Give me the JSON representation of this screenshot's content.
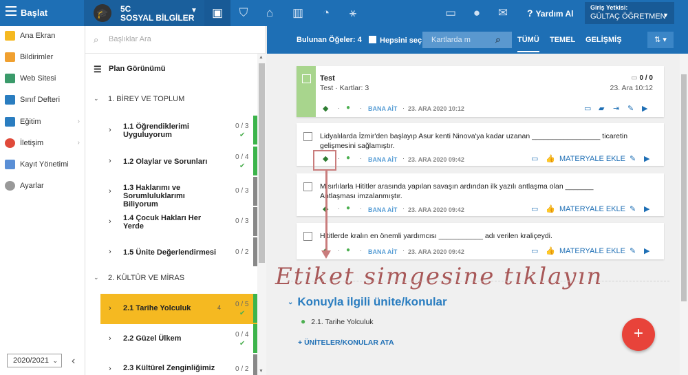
{
  "topbar": {
    "title": "Başlat",
    "class_line1": "5C",
    "class_line2": "SOSYAL BİLGİLER",
    "help_label": "Yardım Al",
    "user_label": "Giriş Yetkisi:",
    "user_name": "GÜLTAÇ ÖĞRETMEN"
  },
  "leftnav": {
    "items": [
      {
        "label": "Ana Ekran",
        "icon": "star-icon",
        "color": "#f5b921"
      },
      {
        "label": "Bildirimler",
        "icon": "mail-icon",
        "color": "#f0a030"
      },
      {
        "label": "Web Sitesi",
        "icon": "building-icon",
        "color": "#3a9a6a"
      },
      {
        "label": "Sınıf Defteri",
        "icon": "notebook-icon",
        "color": "#2a7dc0"
      },
      {
        "label": "Eğitim",
        "icon": "book-icon",
        "color": "#2a7dc0"
      },
      {
        "label": "İletişim",
        "icon": "chat-icon",
        "color": "#e04a3a"
      },
      {
        "label": "Kayıt Yönetimi",
        "icon": "pen-icon",
        "color": "#5a8fd6"
      },
      {
        "label": "Ayarlar",
        "icon": "gear-icon",
        "color": "#999999"
      }
    ],
    "year": "2020/2021"
  },
  "midpanel": {
    "search_placeholder": "Başlıklar Ara",
    "plan_view": "Plan Görünümü",
    "section1": "1. BİREY VE TOPLUM",
    "section2": "2. KÜLTÜR VE MİRAS",
    "units": [
      {
        "title": "1.1 Öğrendiklerimi Uyguluyorum",
        "count": "0 / 3",
        "check": "✔",
        "bar": "#3cb44b"
      },
      {
        "title": "1.2 Olaylar ve Sorunları",
        "count": "0 / 4",
        "check": "✔",
        "bar": "#3cb44b"
      },
      {
        "title": "1.3 Haklarımı ve Sorumluluklarımı Biliyorum",
        "count": "0 / 3",
        "check": "",
        "bar": "#888888"
      },
      {
        "title": "1.4 Çocuk Hakları Her Yerde",
        "count": "0 / 3",
        "check": "",
        "bar": "#888888"
      },
      {
        "title": "1.5 Ünite Değerlendirmesi",
        "count": "0 / 2",
        "check": "",
        "bar": "#888888"
      },
      {
        "title": "2.1 Tarihe Yolculuk",
        "count": "0 / 5",
        "check": "✔",
        "bar": "#3cb44b",
        "extra": "4"
      },
      {
        "title": "2.2 Güzel Ülkem",
        "count": "0 / 4",
        "check": "✔",
        "bar": "#3cb44b"
      },
      {
        "title": "2.3 Kültürel Zenginliğimiz",
        "count": "0 / 2",
        "check": "",
        "bar": "#888888"
      }
    ]
  },
  "toolbar": {
    "found": "Bulunan Öğeler: 4",
    "select_all": "Hepsini seç",
    "search_placeholder": "Kartlarda m",
    "tabs": [
      "TÜMÜ",
      "TEMEL",
      "GELİŞMİŞ"
    ]
  },
  "cards": {
    "test_title": "Test",
    "test_sub": "Test · Kartlar: 3",
    "test_score": "0 / 0",
    "test_date": "23. Ara 10:12",
    "test_owner": "BANA AİT",
    "test_footer_date": "23. ARA 2020 10:12",
    "q1": "Lidyalılarda İzmir'den başlayıp Asur kenti Ninova'ya kadar uzanan _________________ ticaretin gelişmesini sağlamıştır.",
    "q2": "Mısırlılarla Hititler arasında yapılan savaşın ardından ilk yazılı antlaşma olan _______ Antlaşması imzalanmıştır.",
    "q3": "Hititlerde kralın en önemli yardımcısı ___________ adı verilen kraliçeydi.",
    "owner": "BANA AİT",
    "date": "23. ARA 2020 09:42",
    "add_material": "MATERYALE EKLE"
  },
  "annotation": "Etiket simgesine tıklayın",
  "topics": {
    "heading": "Konuyla ilgili ünite/konular",
    "item": "2.1. Tarihe Yolculuk",
    "assign": "ÜNİTELER/KONULAR ATA"
  }
}
